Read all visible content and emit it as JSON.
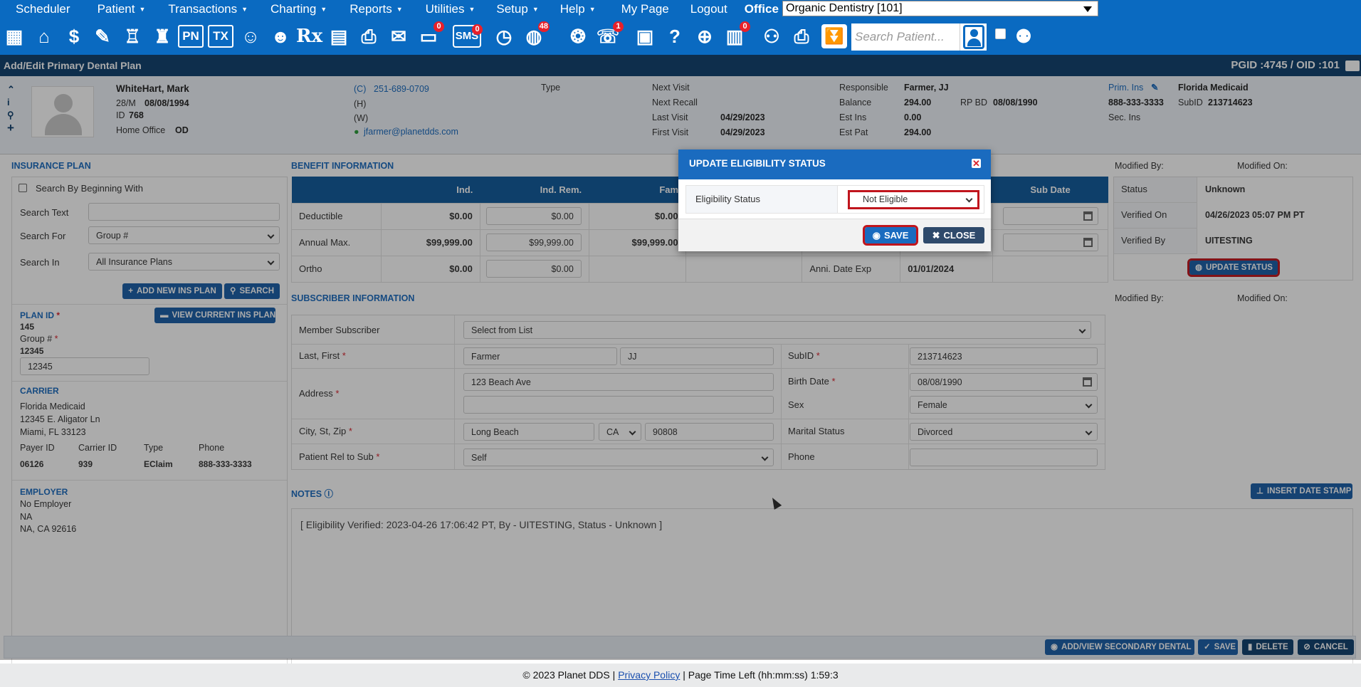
{
  "menu": {
    "items": [
      {
        "label": "Scheduler",
        "caret": false
      },
      {
        "label": "Patient",
        "caret": true
      },
      {
        "label": "Transactions",
        "caret": true
      },
      {
        "label": "Charting",
        "caret": true
      },
      {
        "label": "Reports",
        "caret": true
      },
      {
        "label": "Utilities",
        "caret": true
      },
      {
        "label": "Setup",
        "caret": true
      },
      {
        "label": "Help",
        "caret": true
      },
      {
        "label": "My Page",
        "caret": false
      },
      {
        "label": "Logout",
        "caret": false
      }
    ],
    "office_label": "Office",
    "office_value": "Organic Dentistry [101]"
  },
  "toolbar": {
    "badges": {
      "messages": "0",
      "sms": "0",
      "globe": "48",
      "support": "1",
      "claims": "0"
    },
    "sms_label": "SMS",
    "pn_label": "PN",
    "tx_label": "TX",
    "rx_label": "Rx",
    "search_placeholder": "Search Patient..."
  },
  "title": "Add/Edit Primary Dental Plan",
  "pgid": "PGID :4745  /  OID :101",
  "patient": {
    "name": "WhiteHart, Mark",
    "age_sex": "28/M",
    "dob": "08/08/1994",
    "id_label": "ID",
    "id": "768",
    "home_office_label": "Home Office",
    "home_office": "OD",
    "phone_cell_label": "(C)",
    "phone_cell": "251-689-0709",
    "phone_home_label": "(H)",
    "phone_work_label": "(W)",
    "email": "jfarmer@planetdds.com",
    "type_label": "Type",
    "next_visit_label": "Next Visit",
    "next_recall_label": "Next Recall",
    "last_visit_label": "Last Visit",
    "last_visit": "04/29/2023",
    "first_visit_label": "First Visit",
    "first_visit": "04/29/2023",
    "responsible_label": "Responsible",
    "responsible": "Farmer, JJ",
    "balance_label": "Balance",
    "balance": "294.00",
    "rp_bd_label": "RP BD",
    "rp_bd": "08/08/1990",
    "est_ins_label": "Est Ins",
    "est_ins": "0.00",
    "est_pat_label": "Est Pat",
    "est_pat": "294.00",
    "prim_ins_label": "Prim. Ins",
    "prim_ins": "Florida Medicaid",
    "prim_phone": "888-333-3333",
    "subid_label": "SubID",
    "subid": "213714623",
    "sec_ins_label": "Sec. Ins"
  },
  "insurance_plan": {
    "header": "Insurance Plan",
    "search_beginning_label": "Search By Beginning With",
    "search_text_label": "Search Text",
    "search_for_label": "Search For",
    "search_for_value": "Group #",
    "search_in_label": "Search In",
    "search_in_value": "All Insurance Plans",
    "add_new_btn": "ADD NEW INS PLAN",
    "search_btn": "SEARCH",
    "plan_id_label": "PLAN ID",
    "plan_id": "145",
    "view_current_btn": "VIEW CURRENT INS PLAN",
    "group_label": "Group #",
    "group": "12345",
    "group_input": "12345",
    "carrier_header": "Carrier",
    "carrier_name": "Florida Medicaid",
    "carrier_addr1": "12345 E. Aligator Ln",
    "carrier_addr2": "Miami, FL 33123",
    "payer_id_label": "Payer ID",
    "payer_id": "06126",
    "carrier_id_label": "Carrier ID",
    "carrier_id": "939",
    "type_label": "Type",
    "type": "EClaim",
    "phone_label": "Phone",
    "phone": "888-333-3333",
    "employer_header": "Employer",
    "employer_name": "No Employer",
    "employer_addr1": "NA",
    "employer_addr2": "NA, CA 92616"
  },
  "benefit": {
    "header": "Benefit Information",
    "col_ind": "Ind.",
    "col_ind_rem": "Ind. Rem.",
    "col_fam": "Fam",
    "col_sub_date": "Sub Date",
    "rows": [
      {
        "label": "Deductible",
        "ind": "$0.00",
        "rem": "$0.00",
        "fam": "$0.00"
      },
      {
        "label": "Annual Max.",
        "ind": "$99,999.00",
        "rem": "$99,999.00",
        "fam": "$99,999.00"
      },
      {
        "label": "Ortho",
        "ind": "$0.00",
        "rem": "$0.00",
        "fam": ""
      }
    ],
    "anni_label": "Anni. Date Exp",
    "anni_value": "01/01/2024"
  },
  "eligibility": {
    "modified_by_label": "Modified By:",
    "modified_on_label": "Modified On:",
    "status_label": "Status",
    "status": "Unknown",
    "verified_on_label": "Verified On",
    "verified_on": "04/26/2023 05:07 PM PT",
    "verified_by_label": "Verified By",
    "verified_by": "UITESTING",
    "update_btn": "UPDATE STATUS"
  },
  "subscriber": {
    "header": "Subscriber Information",
    "member_label": "Member Subscriber",
    "member_value": "Select from List",
    "last_first_label": "Last, First",
    "last": "Farmer",
    "first": "JJ",
    "address_label": "Address",
    "address1": "123 Beach Ave",
    "address2": "",
    "city_label": "City, St, Zip",
    "city": "Long Beach",
    "state": "CA",
    "zip": "90808",
    "rel_label": "Patient Rel to Sub",
    "rel": "Self",
    "subid_label": "SubID",
    "subid": "213714623",
    "birth_label": "Birth Date",
    "birth": "08/08/1990",
    "sex_label": "Sex",
    "sex": "Female",
    "marital_label": "Marital Status",
    "marital": "Divorced",
    "phone_label": "Phone",
    "phone": "",
    "modified_by_label": "Modified By:",
    "modified_on_label": "Modified On:"
  },
  "notes": {
    "header": "Notes",
    "insert_btn": "INSERT DATE STAMP",
    "text": "[ Eligibility Verified: 2023-04-26 17:06:42 PT, By - UITESTING, Status - Unknown ]"
  },
  "bottom_buttons": {
    "secondary": "ADD/VIEW SECONDARY DENTAL",
    "save": "SAVE",
    "delete": "DELETE",
    "cancel": "CANCEL"
  },
  "modal": {
    "title": "UPDATE ELIGIBILITY STATUS",
    "field_label": "Eligibility Status",
    "field_value": "Not Eligible",
    "save": "SAVE",
    "close": "CLOSE"
  },
  "footer": {
    "copyright": "© 2023 Planet DDS |",
    "privacy": "Privacy Policy",
    "time_left": "|  Page Time Left (hh:mm:ss) 1:59:3"
  },
  "colors": {
    "brand_blue": "#0a6ac1",
    "navy": "#0f3f6d",
    "header_blue": "#1a6bbf",
    "highlight_red": "#c0151d",
    "badge_red": "#e8202a"
  }
}
